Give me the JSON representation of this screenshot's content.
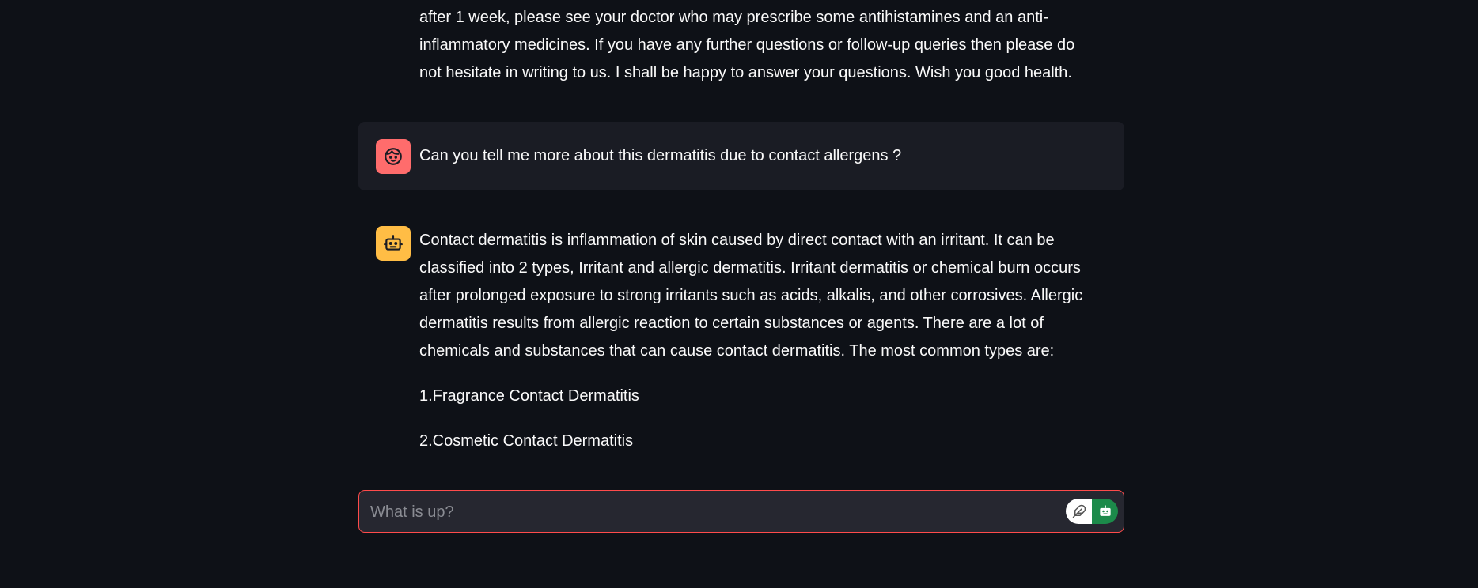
{
  "previous_message": {
    "lines": [
      "after 1 week, please see your doctor who may prescribe some antihistamines and an anti-",
      "inflammatory medicines. If you have any further questions or follow-up queries then please do",
      "not hesitate in writing to us. I shall be happy to answer your questions. Wish you good health."
    ]
  },
  "user_message": {
    "avatar_icon": "face-icon",
    "avatar_color": "#ff6c6c",
    "text": "Can you tell me more about this dermatitis due to contact allergens ?"
  },
  "assistant_message": {
    "avatar_icon": "robot-icon",
    "avatar_color": "#ffbd45",
    "paragraph_lines": [
      "Contact dermatitis is inflammation of skin caused by direct contact with an irritant. It can be",
      "classified into 2 types, Irritant and allergic dermatitis. Irritant dermatitis or chemical burn occurs",
      "after prolonged exposure to strong irritants such as acids, alkalis, and other corrosives. Allergic",
      "dermatitis results from allergic reaction to certain substances or agents. There are a lot of",
      "chemicals and substances that can cause contact dermatitis. The most common types are:"
    ],
    "list_items": [
      "1.Fragrance Contact Dermatitis",
      "2.Cosmetic Contact Dermatitis"
    ]
  },
  "chat_input": {
    "placeholder": "What is up?",
    "value": "",
    "border_color": "#ff4b4b",
    "toggle_left_icon": "feather-icon",
    "toggle_right_icon": "robot-icon",
    "toggle_right_color": "#1c8a4a"
  }
}
